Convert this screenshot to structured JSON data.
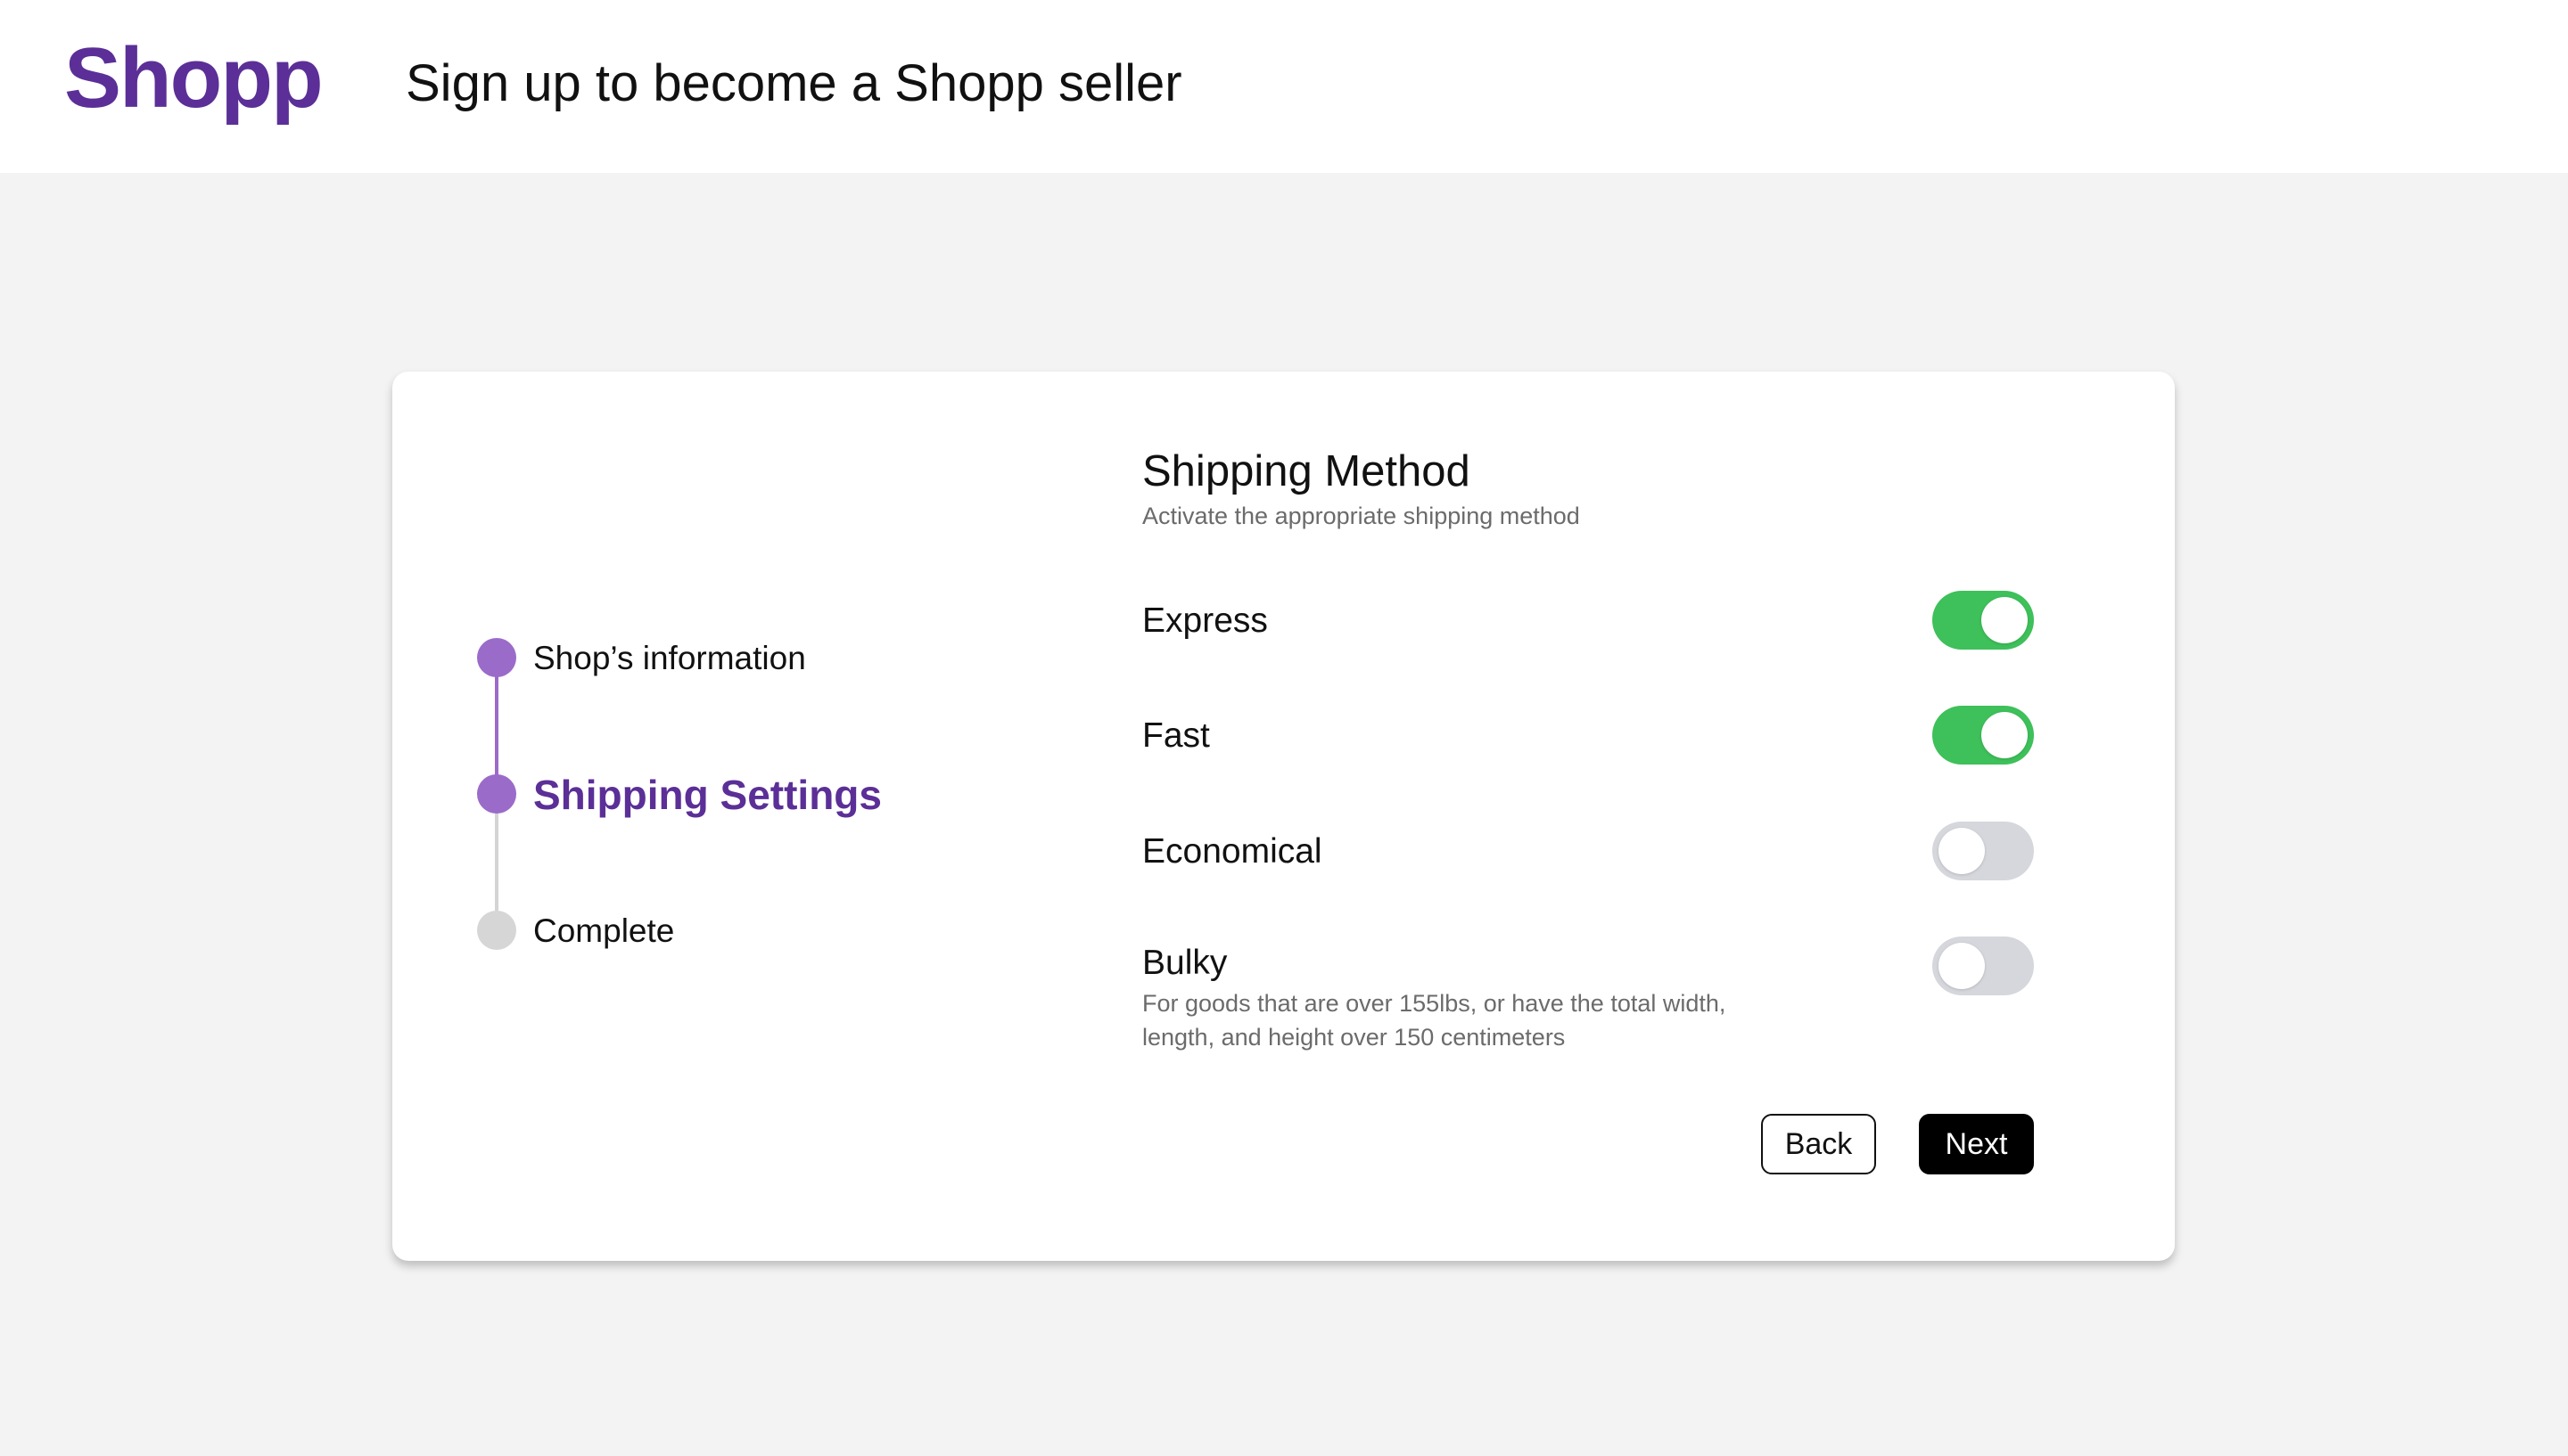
{
  "header": {
    "logo": "Shopp",
    "title": "Sign up to become a Shopp seller"
  },
  "stepper": {
    "steps": [
      {
        "label": "Shop’s information",
        "state": "done"
      },
      {
        "label": "Shipping Settings",
        "state": "current"
      },
      {
        "label": "Complete",
        "state": "todo"
      }
    ]
  },
  "shipping": {
    "title": "Shipping Method",
    "subtitle": "Activate the appropriate shipping method",
    "methods": [
      {
        "label": "Express",
        "enabled": true
      },
      {
        "label": "Fast",
        "enabled": true
      },
      {
        "label": "Economical",
        "enabled": false
      },
      {
        "label": "Bulky",
        "enabled": false,
        "description": "For goods that are over 155lbs, or have the total width, length, and height over 150 centimeters"
      }
    ]
  },
  "actions": {
    "back_label": "Back",
    "next_label": "Next"
  },
  "colors": {
    "brand": "#5b2f97",
    "step_active": "#9b6bc9",
    "toggle_on": "#3ec05a",
    "toggle_off": "#d5d7dc"
  }
}
